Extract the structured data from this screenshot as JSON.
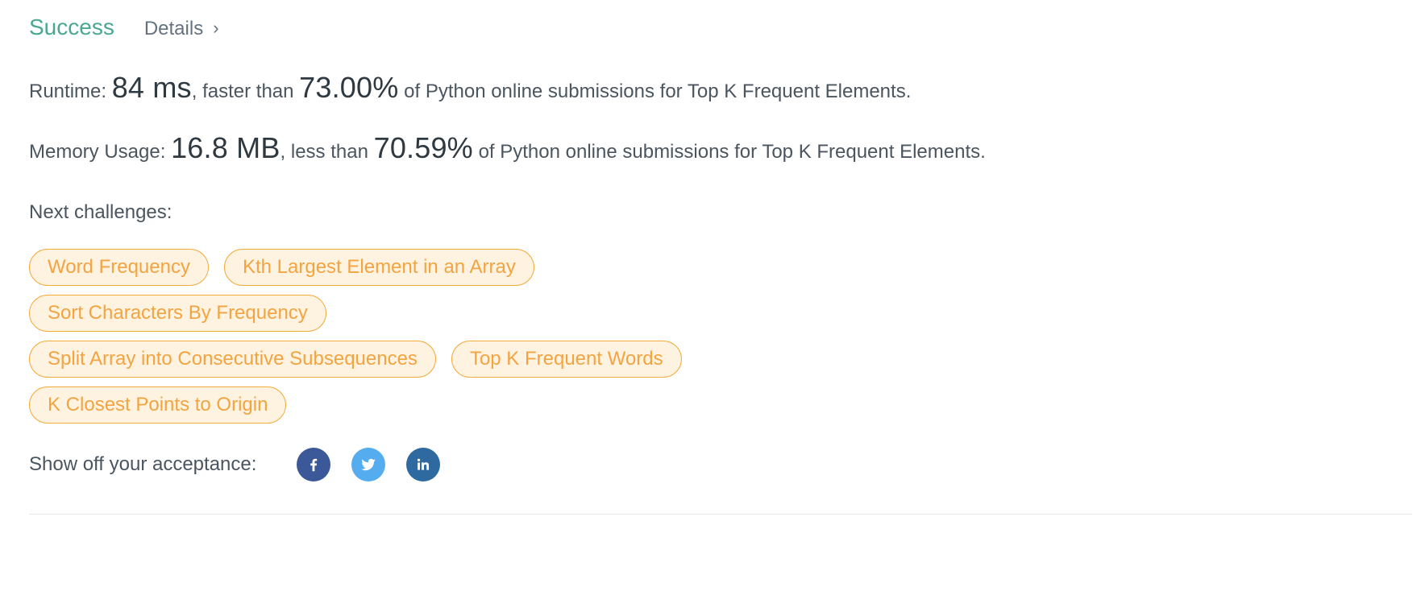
{
  "header": {
    "status": "Success",
    "details_label": "Details",
    "chevron": "chevron-right-icon"
  },
  "runtime": {
    "label": "Runtime: ",
    "value": "84 ms",
    "middle": ", faster than ",
    "percent": "73.00%",
    "suffix": " of Python online submissions for Top K Frequent Elements."
  },
  "memory": {
    "label": "Memory Usage: ",
    "value": "16.8 MB",
    "middle": ", less than ",
    "percent": "70.59%",
    "suffix": " of Python online submissions for Top K Frequent Elements."
  },
  "next_challenges": {
    "title": "Next challenges:",
    "items": [
      "Word Frequency",
      "Kth Largest Element in an Array",
      "Sort Characters By Frequency",
      "Split Array into Consecutive Subsequences",
      "Top K Frequent Words",
      "K Closest Points to Origin"
    ]
  },
  "share": {
    "label": "Show off your acceptance:",
    "icons": [
      "facebook-icon",
      "twitter-icon",
      "linkedin-icon"
    ]
  },
  "colors": {
    "success": "#4ba890",
    "tag_border": "#f3ab3c",
    "tag_bg": "#fef3e1",
    "tag_text": "#f3a440",
    "facebook": "#3b5998",
    "twitter": "#55acee",
    "linkedin": "#2e6aa0"
  }
}
